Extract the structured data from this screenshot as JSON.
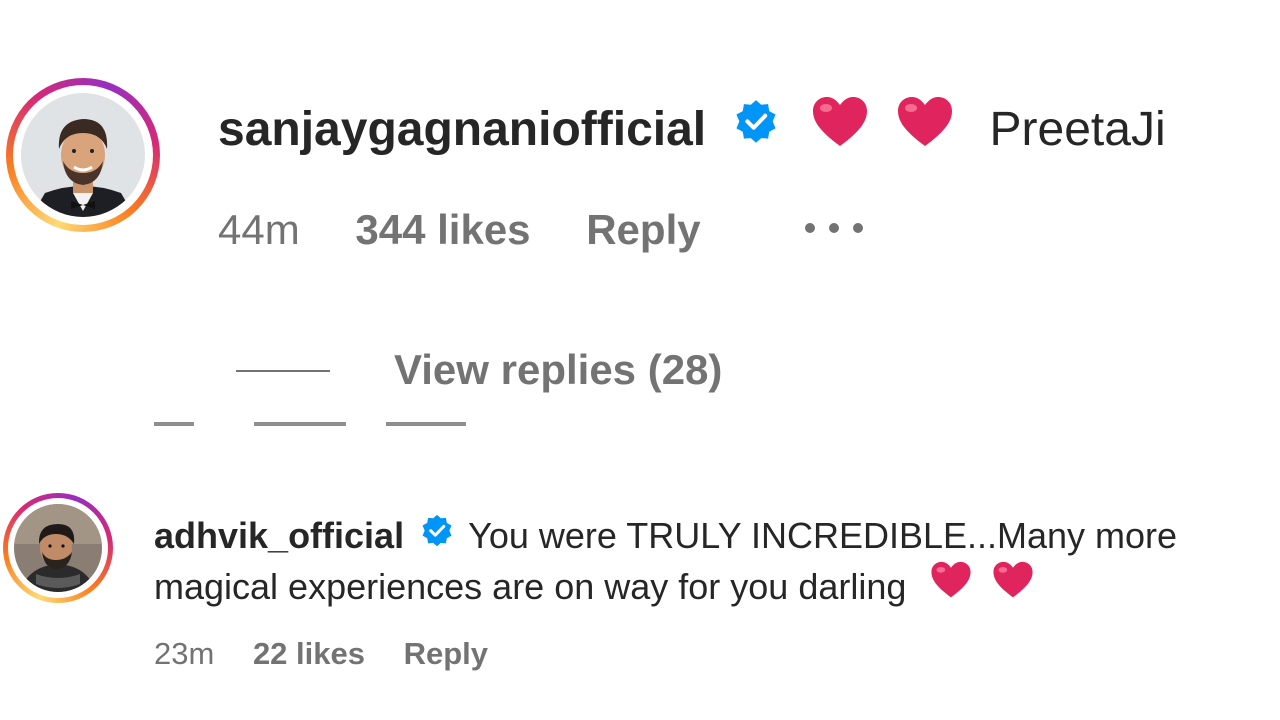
{
  "comment1": {
    "username": "sanjaygagnaniofficial",
    "text": "PreetaJi",
    "time": "44m",
    "likes": "344 likes",
    "reply": "Reply",
    "view_replies": "View replies (28)"
  },
  "comment2": {
    "username": "adhvik_official",
    "text_line1": "You were TRULY INCREDIBLE...Many more",
    "text_line2": "magical experiences are on way for you darling",
    "time": "23m",
    "likes": "22 likes",
    "reply": "Reply"
  },
  "colors": {
    "verified": "#0095f6",
    "heart": "#e0245e",
    "meta": "#737373",
    "text": "#262626"
  }
}
